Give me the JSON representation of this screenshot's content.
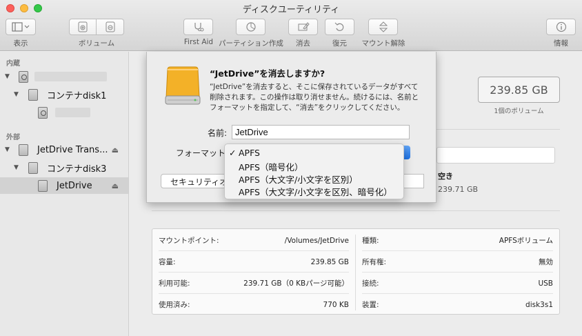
{
  "window": {
    "title": "ディスクユーティリティ"
  },
  "toolbar": {
    "view_label": "表示",
    "volume_label": "ボリューム",
    "firstaid_label": "First Aid",
    "partition_label": "パーティション作成",
    "erase_label": "消去",
    "restore_label": "復元",
    "unmount_label": "マウント解除",
    "info_label": "情報"
  },
  "sidebar": {
    "internal_header": "内蔵",
    "external_header": "外部",
    "items": [
      {
        "label": "コンテナdisk1"
      },
      {
        "label": "JetDrive Trans..."
      },
      {
        "label": "コンテナdisk3"
      },
      {
        "label": "JetDrive"
      }
    ],
    "eject_glyph": "⏏"
  },
  "main": {
    "capacity": "239.85 GB",
    "capacity_sub": "1個のボリューム",
    "free_label": "空き",
    "free_value": "239.71 GB"
  },
  "info": {
    "left": [
      {
        "key": "マウントポイント:",
        "value": "/Volumes/JetDrive"
      },
      {
        "key": "容量:",
        "value": "239.85 GB"
      },
      {
        "key": "利用可能:",
        "value": "239.71 GB（0 KBパージ可能）"
      },
      {
        "key": "使用済み:",
        "value": "770 KB"
      }
    ],
    "right": [
      {
        "key": "種類:",
        "value": "APFSボリューム"
      },
      {
        "key": "所有権:",
        "value": "無効"
      },
      {
        "key": "接続:",
        "value": "USB"
      },
      {
        "key": "装置:",
        "value": "disk3s1"
      }
    ]
  },
  "sheet": {
    "title": "“JetDrive”を消去しますか?",
    "body": "“JetDrive”を消去すると、そこに保存されているデータがすべて削除されます。この操作は取り消せません。続けるには、名前とフォーマットを指定して、“消去”をクリックしてください。",
    "name_label": "名前:",
    "name_value": "JetDrive",
    "format_label": "フォーマット",
    "security_button": "セキュリティオプション..."
  },
  "format_menu": {
    "check": "✓",
    "options": [
      "APFS",
      "APFS（暗号化）",
      "APFS（大文字/小文字を区別）",
      "APFS（大文字/小文字を区別、暗号化）"
    ],
    "selected": "APFS"
  },
  "icons": {
    "sidebar_toggle": "sidebar-icon",
    "add_volume": "add-volume-icon",
    "remove_volume": "remove-volume-icon",
    "first_aid": "stethoscope-icon",
    "partition": "pie-icon",
    "erase": "erase-icon",
    "restore": "restore-icon",
    "unmount": "unmount-icon",
    "info": "info-icon"
  }
}
